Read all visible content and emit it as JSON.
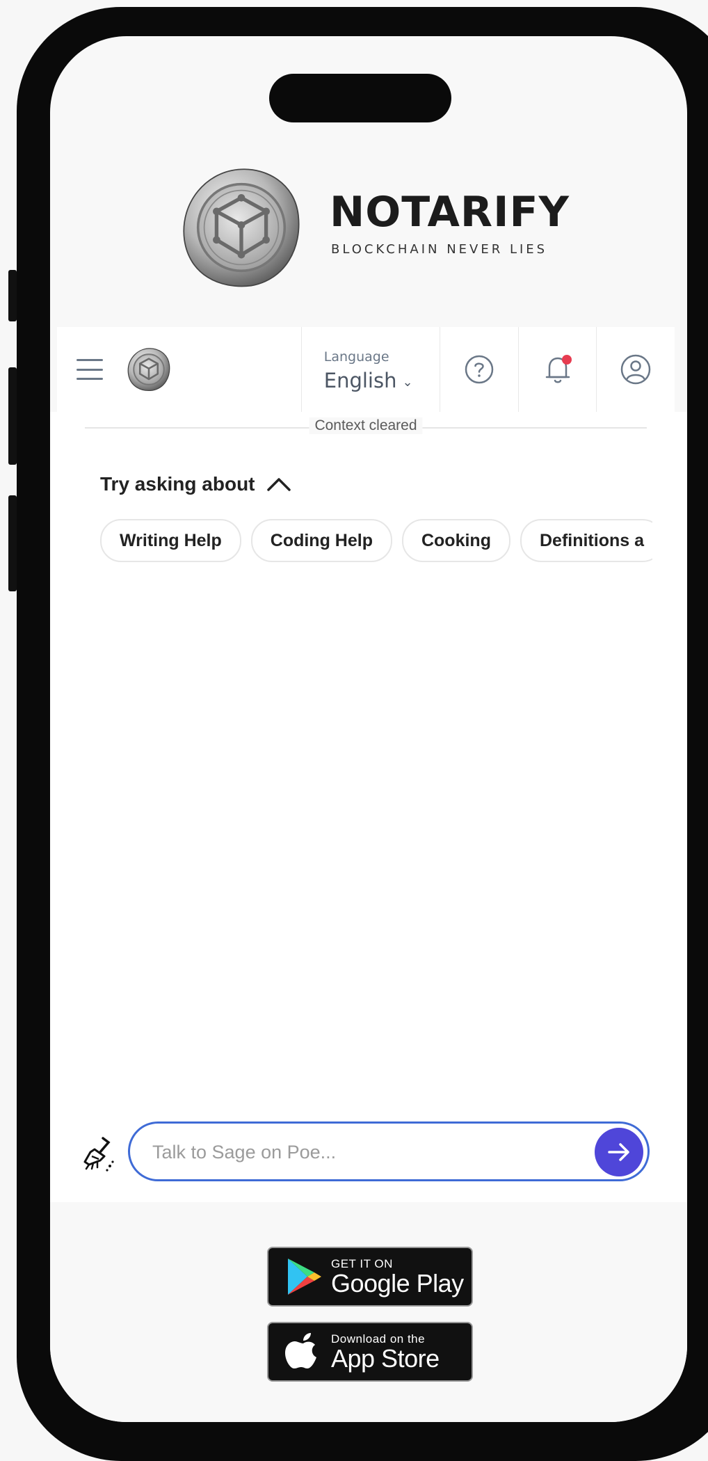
{
  "brand": {
    "title": "NOTARIFY",
    "tagline": "BLOCKCHAIN NEVER LIES"
  },
  "navbar": {
    "language_label": "Language",
    "language_value": "English",
    "icons": [
      "menu-icon",
      "help-icon",
      "bell-icon",
      "user-icon"
    ],
    "notification_dot_color": "#e73c50"
  },
  "chat": {
    "context_status": "Context cleared",
    "suggestions_title": "Try asking about",
    "suggestions": [
      "Writing Help",
      "Coding Help",
      "Cooking",
      "Definitions a"
    ],
    "input_placeholder": "Talk to Sage on Poe...",
    "input_value": "",
    "accent_color": "#4f46d9",
    "input_border_color": "#3f6bd6"
  },
  "stores": {
    "google": {
      "small": "GET IT ON",
      "big": "Google Play"
    },
    "apple": {
      "small": "Download on the",
      "big": "App Store"
    }
  }
}
